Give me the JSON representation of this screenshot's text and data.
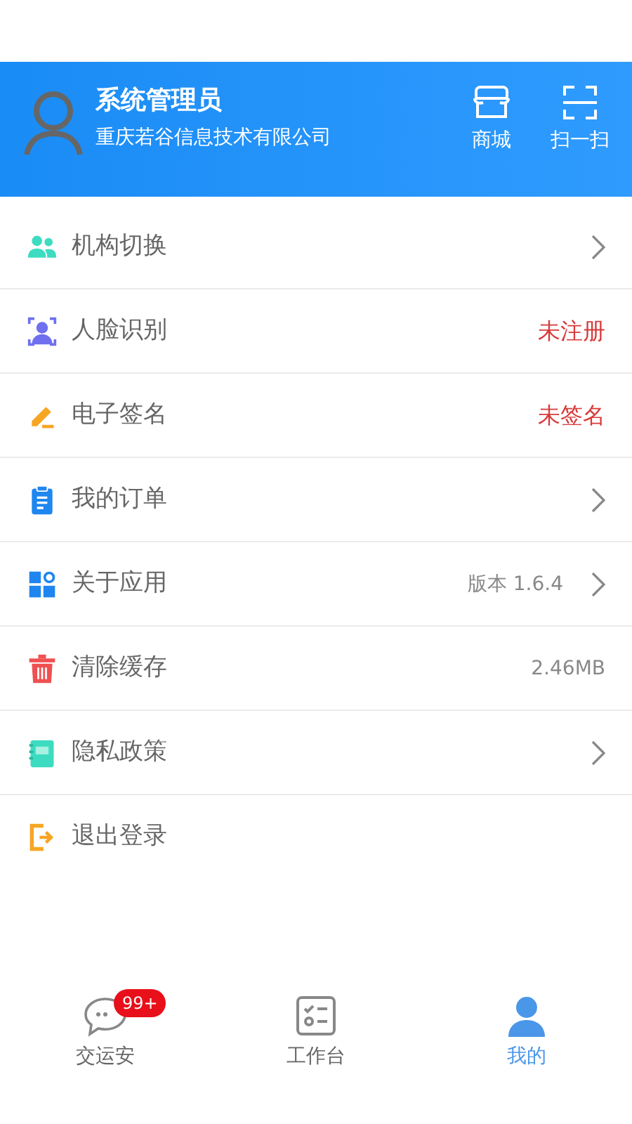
{
  "header": {
    "user_name": "系统管理员",
    "company": "重庆若谷信息技术有限公司",
    "actions": [
      {
        "label": "商城"
      },
      {
        "label": "扫一扫"
      }
    ]
  },
  "menu": [
    {
      "label": "机构切换",
      "chevron": true
    },
    {
      "label": "人脸识别",
      "value": "未注册",
      "kind": "warning",
      "chevron": false
    },
    {
      "label": "电子签名",
      "value": "未签名",
      "kind": "warning",
      "chevron": false
    },
    {
      "label": "我的订单",
      "chevron": true
    },
    {
      "label": "关于应用",
      "value": "版本 1.6.4",
      "kind": "info",
      "chevron": true
    },
    {
      "label": "清除缓存",
      "value": "2.46MB",
      "kind": "info",
      "chevron": false
    },
    {
      "label": "隐私政策",
      "chevron": true
    },
    {
      "label": "退出登录",
      "chevron": false
    }
  ],
  "tabs": [
    {
      "label": "交运安",
      "selected": false,
      "badge": "99+"
    },
    {
      "label": "工作台",
      "selected": false
    },
    {
      "label": "我的",
      "selected": true
    }
  ]
}
